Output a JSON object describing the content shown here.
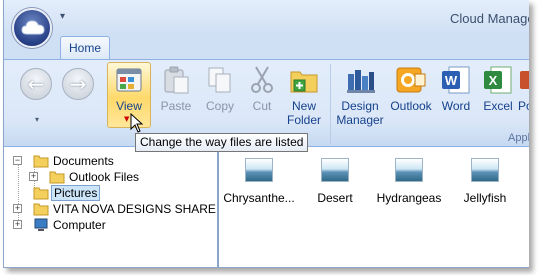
{
  "window": {
    "title": "Cloud Manage",
    "qat_arrow": "▾"
  },
  "tabs": [
    {
      "label": "Home"
    }
  ],
  "ribbon": {
    "nav_dropdown_glyph": "▾",
    "buttons": [
      {
        "id": "view",
        "label": "View",
        "icon": "view-icon",
        "enabled": true
      },
      {
        "id": "paste",
        "label": "Paste",
        "icon": "paste-icon",
        "enabled": false
      },
      {
        "id": "copy",
        "label": "Copy",
        "icon": "copy-icon",
        "enabled": false
      },
      {
        "id": "cut",
        "label": "Cut",
        "icon": "scissors-icon",
        "enabled": false
      },
      {
        "id": "new_folder",
        "label": "New Folder",
        "icon": "new-folder-icon",
        "enabled": true
      },
      {
        "id": "design_manager",
        "label": "Design Manager",
        "icon": "design-manager-icon",
        "enabled": true
      },
      {
        "id": "outlook",
        "label": "Outlook",
        "icon": "outlook-icon",
        "enabled": true
      },
      {
        "id": "word",
        "label": "Word",
        "icon": "word-icon",
        "enabled": true
      },
      {
        "id": "excel",
        "label": "Excel",
        "icon": "excel-icon",
        "enabled": true
      },
      {
        "id": "more",
        "label": "Po",
        "icon": "powerpoint-icon",
        "enabled": true
      }
    ],
    "new_folder_line1": "New",
    "new_folder_line2": "Folder",
    "design_manager_line1": "Design",
    "design_manager_line2": "Manager",
    "group_applications": "Applicatio"
  },
  "tooltip": {
    "text": "Change the way files are listed"
  },
  "tree": {
    "items": [
      {
        "label": "Documents",
        "expander": "−"
      },
      {
        "label": "Outlook Files",
        "expander": "+"
      },
      {
        "label": "Pictures",
        "expander": "",
        "selected": true
      },
      {
        "label": "VITA NOVA DESIGNS SHARE",
        "expander": "+"
      },
      {
        "label": "Computer",
        "expander": "+"
      }
    ]
  },
  "files": [
    {
      "name": "Chrysanthe..."
    },
    {
      "name": "Desert"
    },
    {
      "name": "Hydrangeas"
    },
    {
      "name": "Jellyfish"
    }
  ],
  "colors": {
    "accent": "#15428b",
    "ribbon_bg": "#dbe7f8",
    "selection": "#cce4f7",
    "hover": "#ffd96a"
  }
}
